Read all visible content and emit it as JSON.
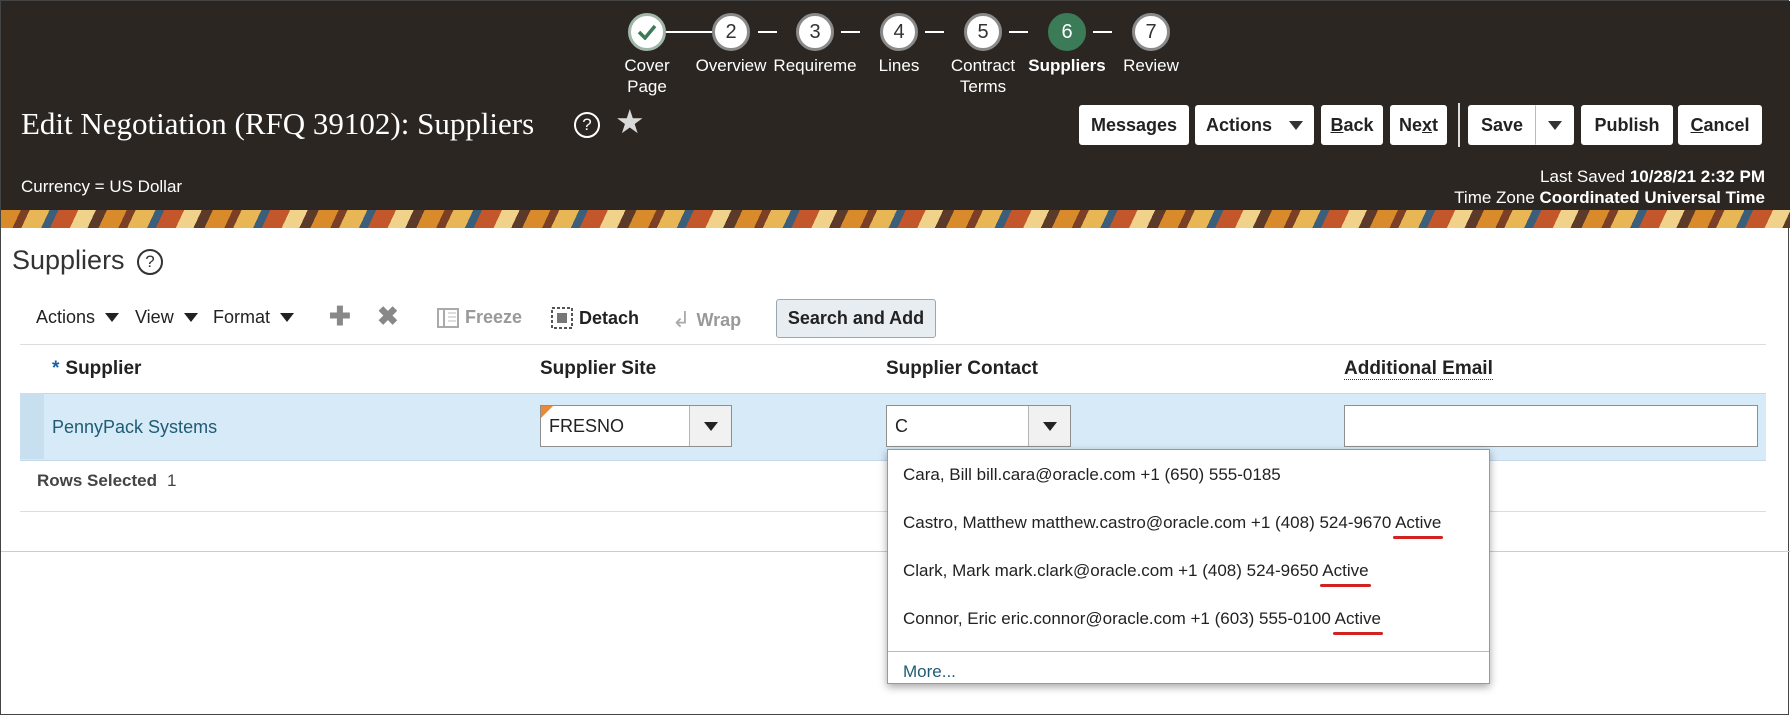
{
  "train": {
    "stops": [
      {
        "number": "",
        "label_line1": "Cover",
        "label_line2": "Page",
        "state": "done"
      },
      {
        "number": "2",
        "label_line1": "Overview",
        "label_line2": "",
        "state": "todo"
      },
      {
        "number": "3",
        "label_line1": "Requireme",
        "label_line2": "",
        "state": "todo"
      },
      {
        "number": "4",
        "label_line1": "Lines",
        "label_line2": "",
        "state": "todo"
      },
      {
        "number": "5",
        "label_line1": "Contract",
        "label_line2": "Terms",
        "state": "todo"
      },
      {
        "number": "6",
        "label_line1": "Suppliers",
        "label_line2": "",
        "state": "current"
      },
      {
        "number": "7",
        "label_line1": "Review",
        "label_line2": "",
        "state": "todo"
      }
    ],
    "check_icon": "checkmark-icon",
    "current_color": "#3c7b57"
  },
  "header": {
    "title": "Edit Negotiation (RFQ 39102): Suppliers",
    "help_glyph": "?",
    "favorite_icon": "star-icon",
    "currency": "Currency = US Dollar",
    "last_saved_label": "Last Saved",
    "last_saved_value": "10/28/21 2:32 PM",
    "time_zone_label": "Time Zone",
    "time_zone_value": "Coordinated Universal Time",
    "buttons": {
      "messages": "Messages",
      "actions": "Actions",
      "back_first": "B",
      "back_rest": "ack",
      "next_first": "Ne",
      "next_u": "x",
      "next_rest": "t",
      "save": "Save",
      "publish": "Publish",
      "cancel_first": "C",
      "cancel_rest": "ancel"
    }
  },
  "section": {
    "title": "Suppliers",
    "help_glyph": "?"
  },
  "toolbar": {
    "actions": "Actions",
    "view": "View",
    "format": "Format",
    "add_icon": "plus-icon",
    "delete_icon": "delete-x-icon",
    "freeze": "Freeze",
    "detach": "Detach",
    "wrap": "Wrap",
    "search_and_add": "Search and Add"
  },
  "table": {
    "required_marker": "*",
    "columns": [
      "Supplier",
      "Supplier Site",
      "Supplier Contact",
      "Additional Email"
    ],
    "row": {
      "supplier": "PennyPack Systems",
      "site": "FRESNO",
      "contact_input": "C",
      "additional_email": ""
    },
    "rows_selected_label": "Rows Selected",
    "rows_selected_value": "1"
  },
  "contact_dropdown": {
    "items": [
      {
        "text": "Cara, Bill bill.cara@oracle.com +1 (650) 555-0185",
        "status": ""
      },
      {
        "text": "Castro, Matthew matthew.castro@oracle.com +1 (408) 524-9670",
        "status": "Active"
      },
      {
        "text": "Clark, Mark mark.clark@oracle.com +1 (408) 524-9650",
        "status": "Active"
      },
      {
        "text": "Connor, Eric eric.connor@oracle.com +1 (603) 555-0100",
        "status": "Active"
      }
    ],
    "more": "More...",
    "highlight_color": "#d32222"
  }
}
